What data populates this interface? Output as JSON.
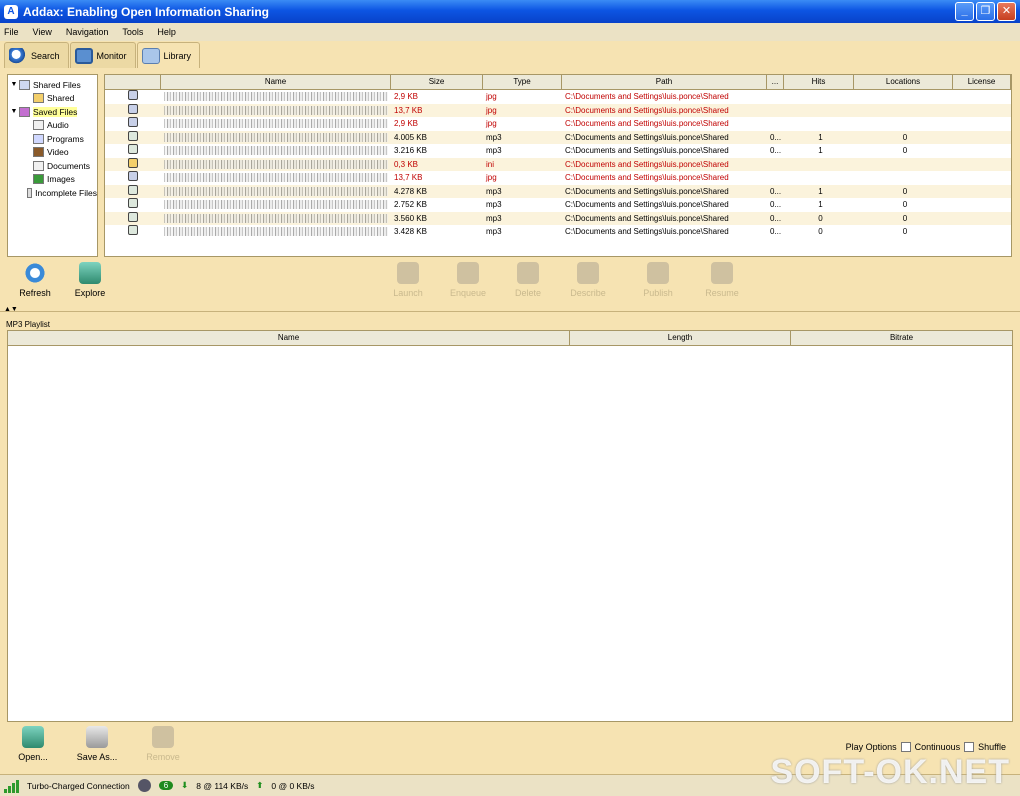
{
  "window": {
    "title": "Addax: Enabling Open Information Sharing"
  },
  "menu": [
    "File",
    "View",
    "Navigation",
    "Tools",
    "Help"
  ],
  "tabs": [
    {
      "label": "Search",
      "icon": "search-icon"
    },
    {
      "label": "Monitor",
      "icon": "monitor-icon"
    },
    {
      "label": "Library",
      "icon": "folder-icon"
    }
  ],
  "tree": [
    {
      "label": "Shared Files",
      "icon": "shared-files-icon",
      "expanded": true
    },
    {
      "label": "Shared",
      "icon": "folder-icon"
    },
    {
      "label": "Saved Files",
      "icon": "saved-files-icon",
      "expanded": true,
      "selected": true
    },
    {
      "label": "Audio",
      "icon": "audio-icon"
    },
    {
      "label": "Programs",
      "icon": "programs-icon"
    },
    {
      "label": "Video",
      "icon": "video-icon"
    },
    {
      "label": "Documents",
      "icon": "documents-icon"
    },
    {
      "label": "Images",
      "icon": "images-icon"
    },
    {
      "label": "Incomplete Files",
      "icon": "incomplete-icon"
    }
  ],
  "table": {
    "headers": [
      "",
      "Name",
      "Size",
      "Type",
      "Path",
      "...",
      "Hits",
      "Locations",
      "License"
    ],
    "rows": [
      {
        "size": "2,9 KB",
        "type": "jpg",
        "path": "C:\\Documents and Settings\\luis.ponce\\Shared",
        "dots": "",
        "hits": "",
        "loc": "",
        "red": true
      },
      {
        "size": "13,7 KB",
        "type": "jpg",
        "path": "C:\\Documents and Settings\\luis.ponce\\Shared",
        "dots": "",
        "hits": "",
        "loc": "",
        "red": true
      },
      {
        "size": "2,9 KB",
        "type": "jpg",
        "path": "C:\\Documents and Settings\\luis.ponce\\Shared",
        "dots": "",
        "hits": "",
        "loc": "",
        "red": true
      },
      {
        "size": "4.005 KB",
        "type": "mp3",
        "path": "C:\\Documents and Settings\\luis.ponce\\Shared",
        "dots": "0...",
        "hits": "1",
        "loc": "0",
        "red": false
      },
      {
        "size": "3.216 KB",
        "type": "mp3",
        "path": "C:\\Documents and Settings\\luis.ponce\\Shared",
        "dots": "0...",
        "hits": "1",
        "loc": "0",
        "red": false
      },
      {
        "size": "0,3 KB",
        "type": "ini",
        "path": "C:\\Documents and Settings\\luis.ponce\\Shared",
        "dots": "",
        "hits": "",
        "loc": "",
        "red": true
      },
      {
        "size": "13,7 KB",
        "type": "jpg",
        "path": "C:\\Documents and Settings\\luis.ponce\\Shared",
        "dots": "",
        "hits": "",
        "loc": "",
        "red": true
      },
      {
        "size": "4.278 KB",
        "type": "mp3",
        "path": "C:\\Documents and Settings\\luis.ponce\\Shared",
        "dots": "0...",
        "hits": "1",
        "loc": "0",
        "red": false
      },
      {
        "size": "2.752 KB",
        "type": "mp3",
        "path": "C:\\Documents and Settings\\luis.ponce\\Shared",
        "dots": "0...",
        "hits": "1",
        "loc": "0",
        "red": false
      },
      {
        "size": "3.560 KB",
        "type": "mp3",
        "path": "C:\\Documents and Settings\\luis.ponce\\Shared",
        "dots": "0...",
        "hits": "0",
        "loc": "0",
        "red": false
      },
      {
        "size": "3.428 KB",
        "type": "mp3",
        "path": "C:\\Documents and Settings\\luis.ponce\\Shared",
        "dots": "0...",
        "hits": "0",
        "loc": "0",
        "red": false
      }
    ]
  },
  "library_actions": {
    "left": [
      {
        "label": "Refresh",
        "icon": "refresh-icon"
      },
      {
        "label": "Explore",
        "icon": "explore-icon"
      }
    ],
    "disabled": [
      {
        "label": "Launch",
        "icon": "launch-icon"
      },
      {
        "label": "Enqueue",
        "icon": "enqueue-icon"
      },
      {
        "label": "Delete",
        "icon": "delete-icon"
      },
      {
        "label": "Describe",
        "icon": "describe-icon"
      },
      {
        "label": "Publish",
        "icon": "publish-icon"
      },
      {
        "label": "Resume",
        "icon": "resume-icon"
      }
    ]
  },
  "playlist": {
    "label": "MP3 Playlist",
    "headers": [
      "Name",
      "Length",
      "Bitrate"
    ]
  },
  "playlist_actions": [
    {
      "label": "Open...",
      "icon": "open-icon",
      "enabled": true
    },
    {
      "label": "Save As...",
      "icon": "save-icon",
      "enabled": true
    },
    {
      "label": "Remove",
      "icon": "remove-icon",
      "enabled": false
    }
  ],
  "play_options": {
    "label": "Play Options",
    "continuous": "Continuous",
    "shuffle": "Shuffle"
  },
  "status": {
    "connection": "Turbo-Charged Connection",
    "badge": "6",
    "down": "8 @ 114 KB/s",
    "up": "0 @ 0 KB/s"
  },
  "watermark": "SOFT-OK.NET"
}
